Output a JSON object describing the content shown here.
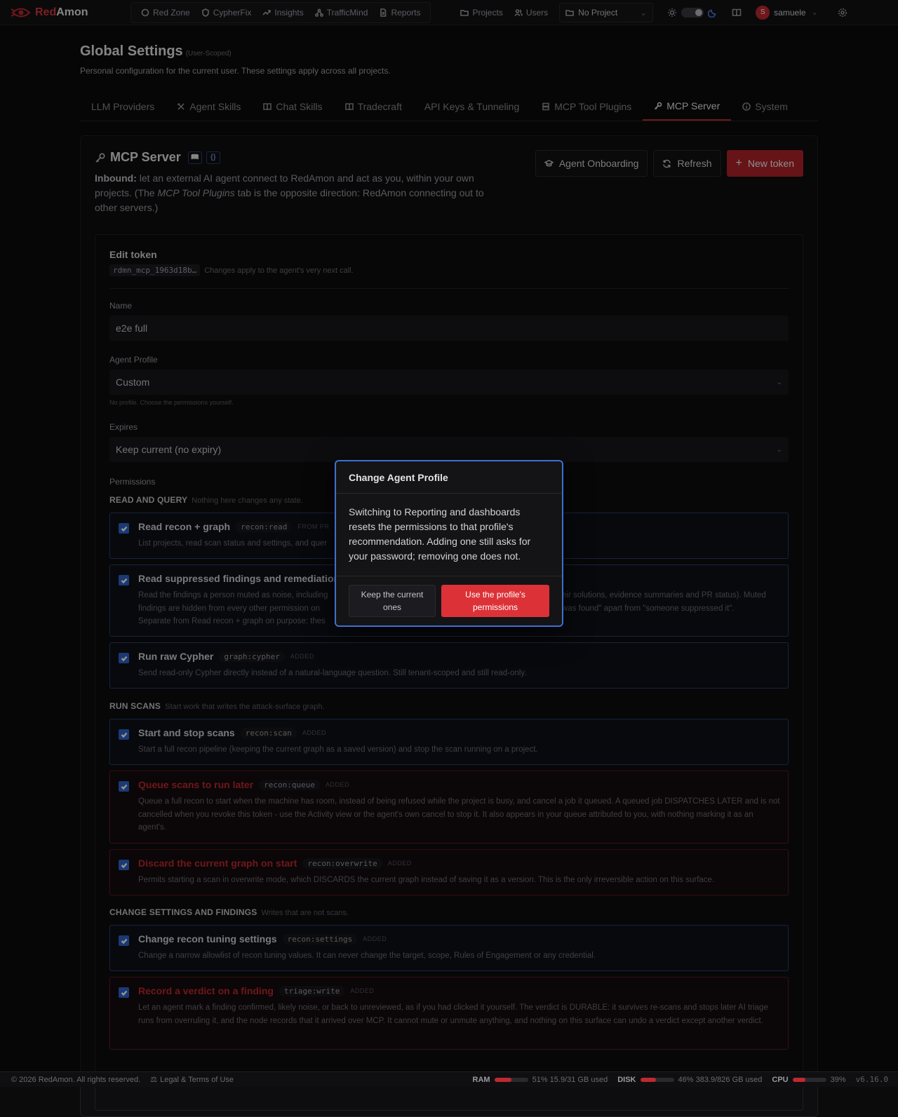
{
  "topbar": {
    "brand_prefix": "Red",
    "brand_suffix": "Amon",
    "nav_left": [
      {
        "label": "Red Zone",
        "icon": "shield-icon"
      },
      {
        "label": "CypherFix",
        "icon": "shield-check-icon"
      },
      {
        "label": "Insights",
        "icon": "trend-icon"
      },
      {
        "label": "TrafficMind",
        "icon": "network-icon"
      },
      {
        "label": "Reports",
        "icon": "document-icon"
      }
    ],
    "nav_right": [
      {
        "label": "Projects",
        "icon": "folder-icon"
      },
      {
        "label": "Users",
        "icon": "users-icon"
      }
    ],
    "project_select": "No Project",
    "user": {
      "initial": "S",
      "name": "samuele"
    }
  },
  "page": {
    "title": "Global Settings",
    "title_suffix": "(User-Scoped)",
    "subtitle": "Personal configuration for the current user. These settings apply across all projects."
  },
  "tabs": [
    {
      "label": "LLM Providers",
      "icon": ""
    },
    {
      "label": "Agent Skills",
      "icon": "skills-icon"
    },
    {
      "label": "Chat Skills",
      "icon": "book-icon"
    },
    {
      "label": "Tradecraft",
      "icon": "book-icon"
    },
    {
      "label": "API Keys & Tunneling",
      "icon": ""
    },
    {
      "label": "MCP Tool Plugins",
      "icon": "server-icon"
    },
    {
      "label": "MCP Server",
      "icon": "key-icon",
      "active": true
    },
    {
      "label": "System",
      "icon": "info-icon"
    }
  ],
  "panel": {
    "title": "MCP Server",
    "desc_bold": "Inbound:",
    "desc_1": " let an external AI agent connect to RedAmon and act as you, within your own projects. (The ",
    "desc_em": "MCP Tool Plugins",
    "desc_2": " tab is the opposite direction: RedAmon connecting out to other servers.)",
    "actions": {
      "onboarding": "Agent Onboarding",
      "refresh": "Refresh",
      "new_token": "New token"
    }
  },
  "edit": {
    "title": "Edit token",
    "token_id": "rdmn_mcp_1963d18b…",
    "token_note": "Changes apply to the agent's very next call.",
    "name_label": "Name",
    "name_value": "e2e full",
    "profile_label": "Agent Profile",
    "profile_value": "Custom",
    "profile_hint": "No profile. Choose the permissions yourself.",
    "expires_label": "Expires",
    "expires_value": "Keep current (no expiry)",
    "permissions_label": "Permissions"
  },
  "sections": [
    {
      "title": "READ AND QUERY",
      "hint": "Nothing here changes any state."
    },
    {
      "title": "RUN SCANS",
      "hint": "Start work that writes the attack-surface graph."
    },
    {
      "title": "CHANGE SETTINGS AND FINDINGS",
      "hint": "Writes that are not scans."
    }
  ],
  "permissions": [
    {
      "title": "Read recon + graph",
      "scope": "recon:read",
      "tag": "FROM PR",
      "desc": "List projects, read scan status and settings, and quer",
      "danger": false
    },
    {
      "title": "Read suppressed findings and remediations",
      "scope": "",
      "tag": "",
      "desc_a": "Read the findings a person muted as noise, including",
      "desc_b": "eir solutions, evidence summaries and PR status). Muted",
      "desc_c": "findings are hidden from every other permission on",
      "desc_d": "was found\" apart from \"someone suppressed it\".",
      "desc_e": "Separate from Read recon + graph on purpose: thes",
      "danger": false
    },
    {
      "title": "Run raw Cypher",
      "scope": "graph:cypher",
      "tag": "ADDED",
      "desc": "Send read-only Cypher directly instead of a natural-language question. Still tenant-scoped and still read-only.",
      "danger": false
    },
    {
      "title": "Start and stop scans",
      "scope": "recon:scan",
      "tag": "ADDED",
      "desc": "Start a full recon pipeline (keeping the current graph as a saved version) and stop the scan running on a project.",
      "danger": false
    },
    {
      "title": "Queue scans to run later",
      "scope": "recon:queue",
      "tag": "ADDED",
      "desc": "Queue a full recon to start when the machine has room, instead of being refused while the project is busy, and cancel a job it queued. A queued job DISPATCHES LATER and is not cancelled when you revoke this token - use the Activity view or the agent's own cancel to stop it. It also appears in your queue attributed to you, with nothing marking it as an agent's.",
      "danger": true
    },
    {
      "title": "Discard the current graph on start",
      "scope": "recon:overwrite",
      "tag": "ADDED",
      "desc": "Permits starting a scan in overwrite mode, which DISCARDS the current graph instead of saving it as a version. This is the only irreversible action on this surface.",
      "danger": true
    },
    {
      "title": "Change recon tuning settings",
      "scope": "recon:settings",
      "tag": "ADDED",
      "desc": "Change a narrow allowlist of recon tuning values. It can never change the target, scope, Rules of Engagement or any credential.",
      "danger": false
    },
    {
      "title": "Record a verdict on a finding",
      "scope": "triage:write",
      "tag": "ADDED",
      "desc": "Let an agent mark a finding confirmed, likely noise, or back to unreviewed, as if you had clicked it yourself. The verdict is DURABLE: it survives re-scans and stops later AI triage runs from overruling it, and the node records that it arrived over MCP. It cannot mute or unmute anything, and nothing on this surface can undo a verdict except another verdict.",
      "danger": true
    }
  ],
  "modal": {
    "title": "Change Agent Profile",
    "body": "Switching to Reporting and dashboards resets the permissions to that profile's recommendation. Adding one still asks for your password; removing one does not.",
    "cancel": "Keep the current ones",
    "confirm": "Use the profile's permissions"
  },
  "footer": {
    "copyright": "© 2026 RedAmon. All rights reserved.",
    "legal": "Legal & Terms of Use",
    "ram_label": "RAM",
    "ram_pct": 51,
    "ram_text": "51% 15.9/31 GB used",
    "disk_label": "DISK",
    "disk_pct": 46,
    "disk_text": "46% 383.9/826 GB used",
    "cpu_label": "CPU",
    "cpu_pct": 39,
    "cpu_text": "39%",
    "version": "v6.16.0"
  },
  "colors": {
    "accent": "#c0292f",
    "focus": "#3f6fd0",
    "checkbox": "#2f62c8"
  }
}
